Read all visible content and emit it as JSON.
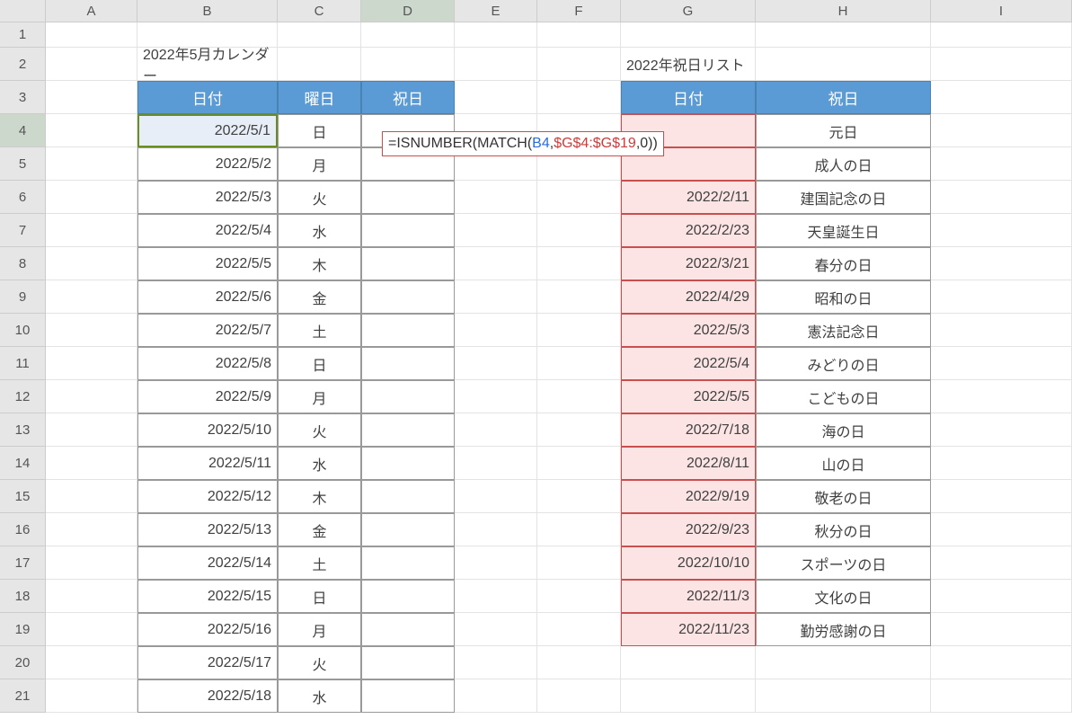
{
  "cols": [
    "A",
    "B",
    "C",
    "D",
    "E",
    "F",
    "G",
    "H",
    "I"
  ],
  "rows": [
    "1",
    "2",
    "3",
    "4",
    "5",
    "6",
    "7",
    "8",
    "9",
    "10",
    "11",
    "12",
    "13",
    "14",
    "15",
    "16",
    "17",
    "18",
    "19",
    "20",
    "21"
  ],
  "titleLeft": "2022年5月カレンダー",
  "titleRight": "2022年祝日リスト",
  "headers": {
    "b": "日付",
    "c": "曜日",
    "d": "祝日",
    "g": "日付",
    "h": "祝日"
  },
  "cal": [
    {
      "date": "2022/5/1",
      "dow": "日"
    },
    {
      "date": "2022/5/2",
      "dow": "月"
    },
    {
      "date": "2022/5/3",
      "dow": "火"
    },
    {
      "date": "2022/5/4",
      "dow": "水"
    },
    {
      "date": "2022/5/5",
      "dow": "木"
    },
    {
      "date": "2022/5/6",
      "dow": "金"
    },
    {
      "date": "2022/5/7",
      "dow": "土"
    },
    {
      "date": "2022/5/8",
      "dow": "日"
    },
    {
      "date": "2022/5/9",
      "dow": "月"
    },
    {
      "date": "2022/5/10",
      "dow": "火"
    },
    {
      "date": "2022/5/11",
      "dow": "水"
    },
    {
      "date": "2022/5/12",
      "dow": "木"
    },
    {
      "date": "2022/5/13",
      "dow": "金"
    },
    {
      "date": "2022/5/14",
      "dow": "土"
    },
    {
      "date": "2022/5/15",
      "dow": "日"
    },
    {
      "date": "2022/5/16",
      "dow": "月"
    },
    {
      "date": "2022/5/17",
      "dow": "火"
    },
    {
      "date": "2022/5/18",
      "dow": "水"
    }
  ],
  "holidays": [
    {
      "date": "",
      "name": "元日"
    },
    {
      "date": "",
      "name": "成人の日"
    },
    {
      "date": "2022/2/11",
      "name": "建国記念の日"
    },
    {
      "date": "2022/2/23",
      "name": "天皇誕生日"
    },
    {
      "date": "2022/3/21",
      "name": "春分の日"
    },
    {
      "date": "2022/4/29",
      "name": "昭和の日"
    },
    {
      "date": "2022/5/3",
      "name": "憲法記念日"
    },
    {
      "date": "2022/5/4",
      "name": "みどりの日"
    },
    {
      "date": "2022/5/5",
      "name": "こどもの日"
    },
    {
      "date": "2022/7/18",
      "name": "海の日"
    },
    {
      "date": "2022/8/11",
      "name": "山の日"
    },
    {
      "date": "2022/9/19",
      "name": "敬老の日"
    },
    {
      "date": "2022/9/23",
      "name": "秋分の日"
    },
    {
      "date": "2022/10/10",
      "name": "スポーツの日"
    },
    {
      "date": "2022/11/3",
      "name": "文化の日"
    },
    {
      "date": "2022/11/23",
      "name": "勤労感謝の日"
    }
  ],
  "formula": {
    "eq": "=",
    "fn1": "ISNUMBER",
    "paren1": "(",
    "fn2": "MATCH",
    "paren2": "(",
    "ref1": "B4",
    "comma1": ",",
    "ref2": "$G$4:$G$19",
    "comma2": ",",
    "zero": "0",
    "close": "))"
  }
}
